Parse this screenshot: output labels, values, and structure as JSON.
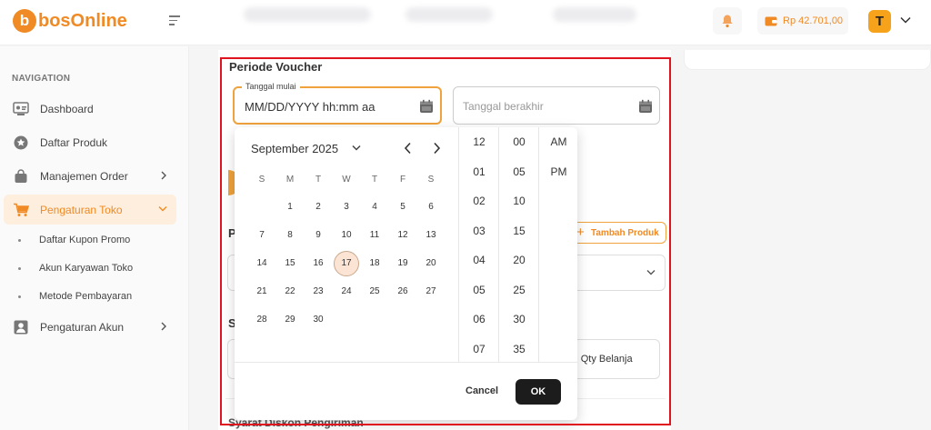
{
  "header": {
    "logo_mark": "b",
    "logo_text": "bosOnline",
    "balance": "Rp 42.701,00",
    "avatar_initial": "T"
  },
  "sidebar": {
    "nav_title": "NAVIGATION",
    "items": [
      {
        "label": "Dashboard"
      },
      {
        "label": "Daftar Produk"
      },
      {
        "label": "Manajemen Order"
      },
      {
        "label": "Pengaturan Toko"
      },
      {
        "label": "Pengaturan Akun"
      }
    ],
    "sub_items": [
      {
        "label": "Daftar Kupon Promo"
      },
      {
        "label": "Akun Karyawan Toko"
      },
      {
        "label": "Metode Pembayaran"
      }
    ]
  },
  "form": {
    "section_title": "Periode Voucher",
    "start_legend": "Tanggal mulai",
    "start_value": "MM/DD/YYYY hh:mm aa",
    "end_placeholder": "Tanggal berakhir",
    "tambah_produk": "Tambah Produk",
    "qty_label": "nal Qty Belanja",
    "bottom_text": "Syarat Diskon Pengiriman",
    "letters": [
      "P",
      "S"
    ]
  },
  "picker": {
    "month_label": "September 2025",
    "weekdays": [
      "S",
      "M",
      "T",
      "W",
      "T",
      "F",
      "S"
    ],
    "days": [
      "1",
      "2",
      "3",
      "4",
      "5",
      "6",
      "7",
      "8",
      "9",
      "10",
      "11",
      "12",
      "13",
      "14",
      "15",
      "16",
      "17",
      "18",
      "19",
      "20",
      "21",
      "22",
      "23",
      "24",
      "25",
      "26",
      "27",
      "28",
      "29",
      "30"
    ],
    "selected_day": "17",
    "hours": [
      "12",
      "01",
      "02",
      "03",
      "04",
      "05",
      "06",
      "07"
    ],
    "minutes": [
      "00",
      "05",
      "10",
      "15",
      "20",
      "25",
      "30",
      "35"
    ],
    "ampm": [
      "AM",
      "PM"
    ],
    "cancel_label": "Cancel",
    "ok_label": "OK"
  },
  "colors": {
    "accent": "#f08a24",
    "highlight_frame": "#e0141e"
  }
}
